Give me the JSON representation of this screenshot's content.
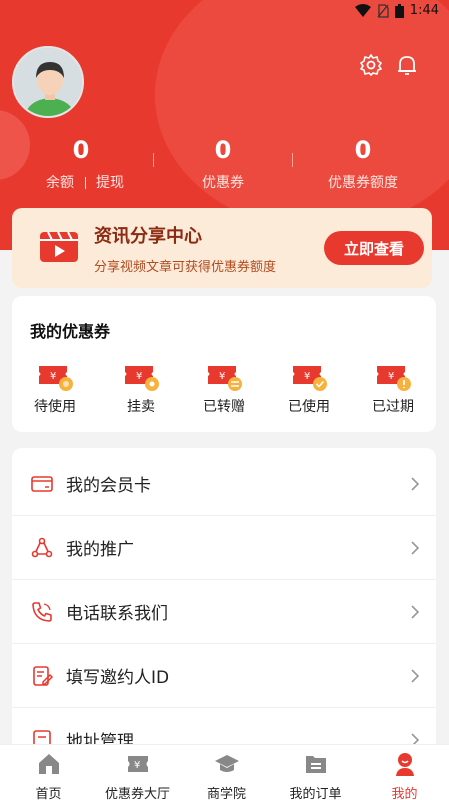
{
  "status_bar": {
    "time": "1:44"
  },
  "balance": {
    "amount": "0",
    "label": "余额",
    "withdraw_label": "提现"
  },
  "coupons_stat": {
    "amount": "0",
    "label": "优惠券"
  },
  "quota_stat": {
    "amount": "0",
    "label": "优惠券额度"
  },
  "banner": {
    "title": "资讯分享中心",
    "subtitle": "分享视频文章可获得优惠券额度",
    "button_label": "立即查看"
  },
  "my_coupons": {
    "heading": "我的优惠券",
    "items": [
      {
        "label": "待使用",
        "icon": "coupon-pending-icon"
      },
      {
        "label": "挂卖",
        "icon": "coupon-selling-icon"
      },
      {
        "label": "已转赠",
        "icon": "coupon-gifted-icon"
      },
      {
        "label": "已使用",
        "icon": "coupon-used-icon"
      },
      {
        "label": "已过期",
        "icon": "coupon-expired-icon"
      }
    ]
  },
  "menu": [
    {
      "label": "我的会员卡",
      "icon": "card-icon"
    },
    {
      "label": "我的推广",
      "icon": "share-network-icon"
    },
    {
      "label": "电话联系我们",
      "icon": "phone-icon"
    },
    {
      "label": "填写邀约人ID",
      "icon": "edit-form-icon"
    },
    {
      "label": "地址管理",
      "icon": "location-icon"
    }
  ],
  "tabbar": [
    {
      "label": "首页",
      "icon": "home-icon"
    },
    {
      "label": "优惠券大厅",
      "icon": "coupon-hall-icon"
    },
    {
      "label": "商学院",
      "icon": "graduation-cap-icon"
    },
    {
      "label": "我的订单",
      "icon": "order-icon"
    },
    {
      "label": "我的",
      "icon": "profile-icon",
      "active": true
    }
  ],
  "colors": {
    "brand": "#e8392f",
    "banner_bg": "#fdebd9",
    "page_bg": "#f3f3f3"
  }
}
